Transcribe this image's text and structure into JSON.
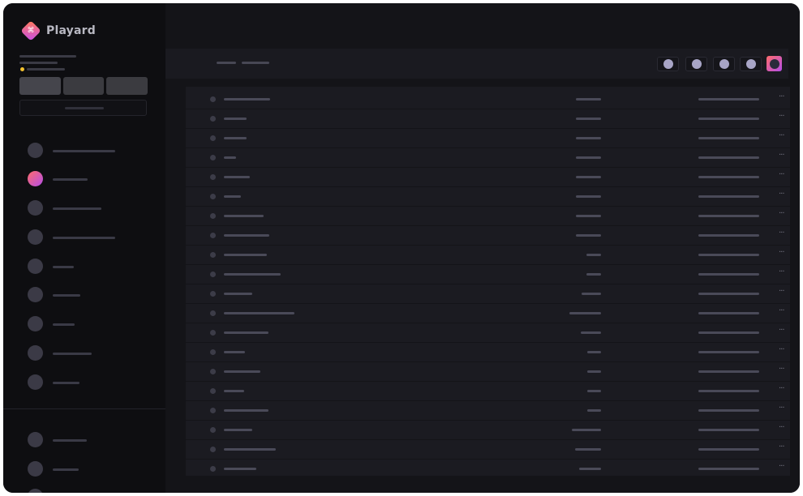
{
  "app": {
    "name": "Playard",
    "brand_gradient": [
      "#ff7a59",
      "#c84fe8"
    ],
    "status_color": "#f2c12e"
  },
  "icons": {
    "logo": "diamond-logo-icon",
    "toolbar": [
      "circle-tool-icon",
      "circle-tool-icon",
      "circle-tool-icon",
      "circle-tool-icon",
      "avatar-gradient-icon"
    ],
    "row_menu": "more-dots-icon"
  },
  "row_menu_glyph": "···"
}
